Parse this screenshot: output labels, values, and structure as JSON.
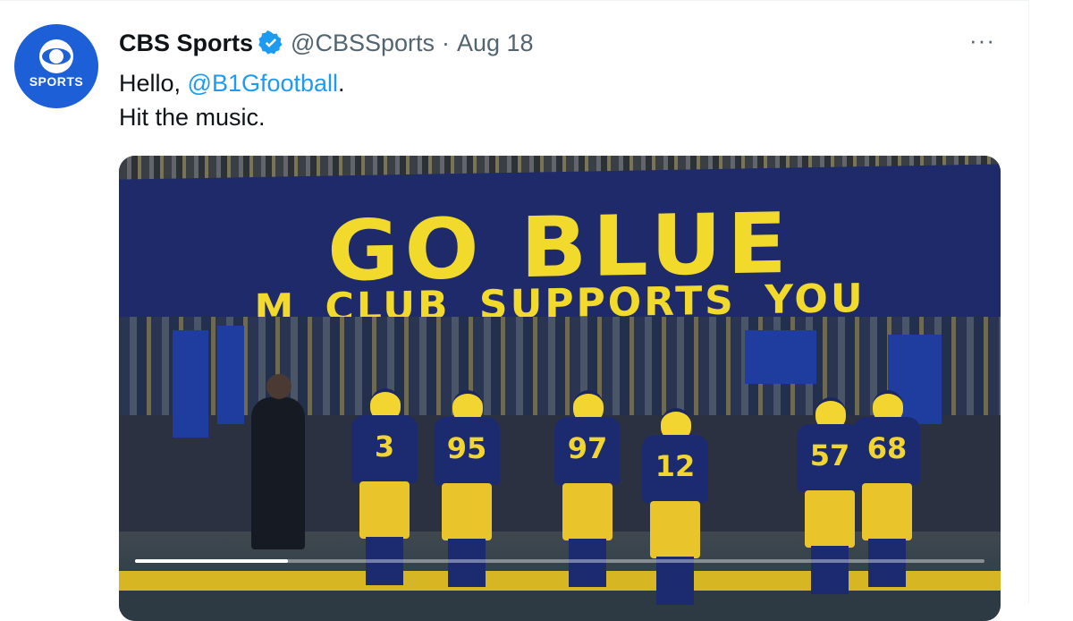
{
  "tweet": {
    "avatar_label": "SPORTS",
    "display_name": "CBS Sports",
    "handle": "@CBSSports",
    "separator": "·",
    "date": "Aug 18",
    "text_prefix": "Hello, ",
    "mention": "@B1Gfootball",
    "text_suffix": ".",
    "line2": "Hit the music.",
    "more_label": "···"
  },
  "media": {
    "banner_line1": "GO BLUE",
    "banner_line2": "M CLUB SUPPORTS YOU",
    "jerseys": [
      "3",
      "95",
      "97",
      "12",
      "57",
      "68"
    ],
    "progress": 0.18
  },
  "colors": {
    "link": "#1d9bf0",
    "verified": "#1d9bf0",
    "avatar": "#1d5fd6",
    "maize": "#f2da2c",
    "blue": "#1f2a6b"
  },
  "icons": [
    "cbs-eye-icon",
    "verified-badge-icon",
    "more-icon"
  ]
}
